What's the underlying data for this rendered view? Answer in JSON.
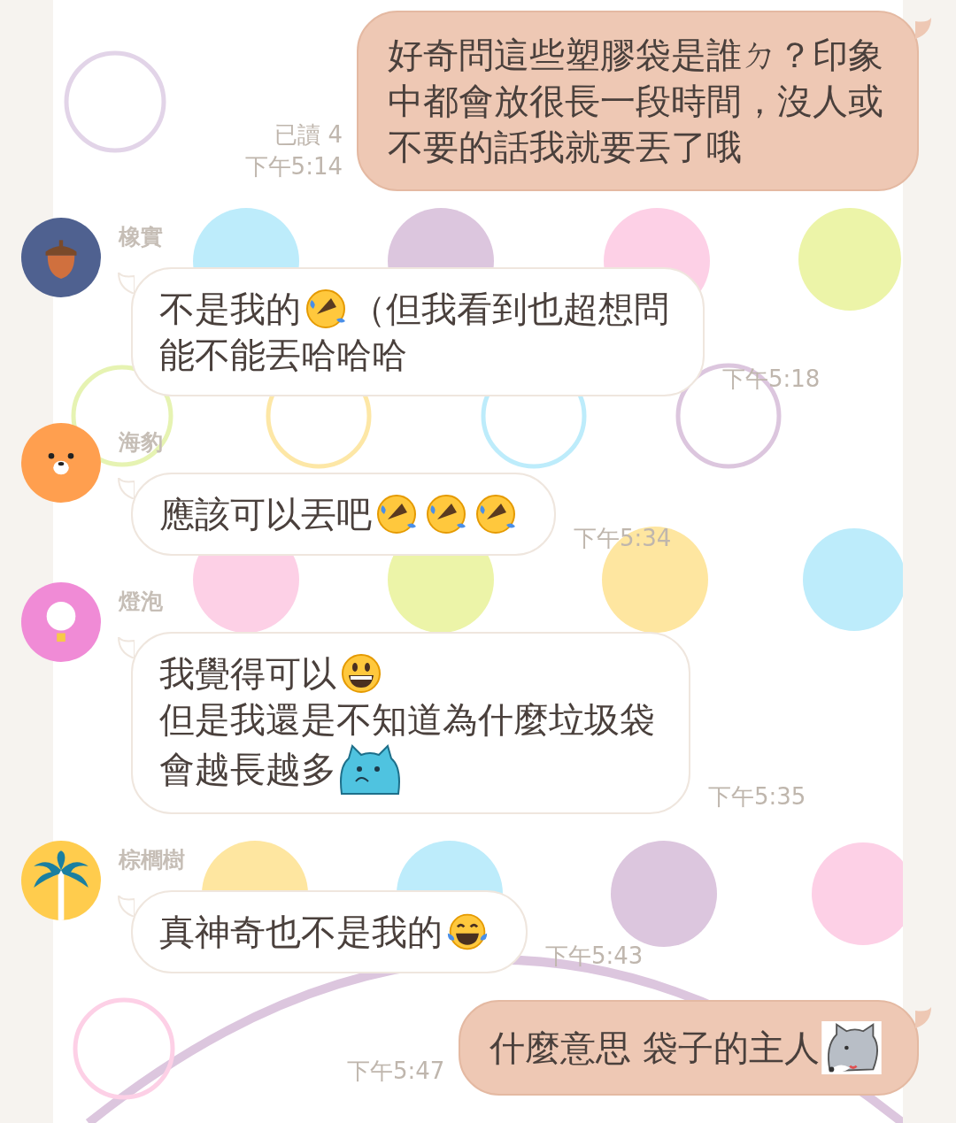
{
  "messages": [
    {
      "kind": "outgoing",
      "read": "已讀 4",
      "time": "下午5:14",
      "lines": [
        [
          {
            "kind": "text",
            "text": "好奇問這些塑膠袋是誰ㄉ？印象"
          }
        ],
        [
          {
            "kind": "text",
            "text": "中都會放很長一段時間，沒人或"
          }
        ],
        [
          {
            "kind": "text",
            "text": "不要的話我就要丟了哦"
          }
        ]
      ]
    },
    {
      "kind": "incoming",
      "sender": "橡實",
      "avatar": {
        "kind": "acorn",
        "color": "#4f6190"
      },
      "time": "下午5:18",
      "lines": [
        [
          {
            "kind": "text",
            "text": "不是我的"
          },
          {
            "kind": "rofl"
          },
          {
            "kind": "text",
            "text": "（但我看到也超想問"
          }
        ],
        [
          {
            "kind": "text",
            "text": "能不能丟哈哈哈"
          }
        ]
      ]
    },
    {
      "kind": "incoming",
      "sender": "海豹",
      "avatar": {
        "kind": "seal",
        "color": "#ff9f4f"
      },
      "time": "下午5:34",
      "lines": [
        [
          {
            "kind": "text",
            "text": "應該可以丟吧"
          },
          {
            "kind": "rofl"
          },
          {
            "kind": "rofl"
          },
          {
            "kind": "rofl"
          }
        ]
      ]
    },
    {
      "kind": "incoming",
      "sender": "燈泡",
      "avatar": {
        "kind": "bulb",
        "color": "#f08bd6"
      },
      "time": "下午5:35",
      "lines": [
        [
          {
            "kind": "text",
            "text": "我覺得可以"
          },
          {
            "kind": "grin"
          }
        ],
        [
          {
            "kind": "text",
            "text": "但是我還是不知道為什麼垃圾袋"
          }
        ],
        [
          {
            "kind": "text",
            "text": "會越長越多"
          },
          {
            "kind": "cat"
          }
        ]
      ]
    },
    {
      "kind": "incoming",
      "sender": "棕櫚樹",
      "avatar": {
        "kind": "palm",
        "color": "#ffcc4d"
      },
      "time": "下午5:43",
      "lines": [
        [
          {
            "kind": "text",
            "text": "真神奇也不是我的"
          },
          {
            "kind": "joy"
          }
        ]
      ]
    },
    {
      "kind": "outgoing",
      "time": "下午5:47",
      "lines": [
        [
          {
            "kind": "text",
            "text": "什麼意思 袋子的主人"
          },
          {
            "kind": "dog"
          }
        ]
      ]
    }
  ]
}
